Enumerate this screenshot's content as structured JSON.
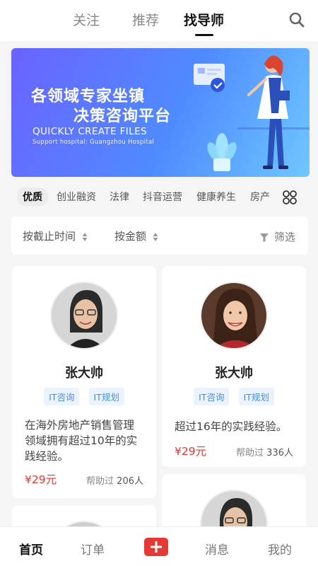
{
  "top_tabs": [
    {
      "label": "关注"
    },
    {
      "label": "推荐"
    },
    {
      "label": "找导师"
    }
  ],
  "search_icon": "search-icon",
  "banner": {
    "title_line1": "各领域专家坐镇",
    "title_line2": "决策咨询平台",
    "english": "QUICKLY CREATE FILES",
    "small": "Support hospital: Guangzhou Hospital"
  },
  "categories": [
    "优质",
    "创业融资",
    "法律",
    "抖音运营",
    "健康养生",
    "房产"
  ],
  "sort": {
    "by_deadline": "按截止时间",
    "by_amount": "按金额",
    "filter": "筛选"
  },
  "cards": [
    {
      "name": "张大帅",
      "tags": [
        "IT咨询",
        "IT规划"
      ],
      "description": "在海外房地产销售管理领域拥有超过10年的实践经验。",
      "price": "¥29元",
      "helped_label": "帮助过",
      "helped_count": "206人"
    },
    {
      "name": "张大帅",
      "tags": [
        "IT咨询",
        "IT规划"
      ],
      "description": "超过16年的实践经验。",
      "price": "¥29元",
      "helped_label": "帮助过",
      "helped_count": "336人"
    }
  ],
  "bottom_nav": [
    {
      "label": "首页"
    },
    {
      "label": "订单"
    },
    {
      "label": "消息"
    },
    {
      "label": "我的"
    }
  ],
  "colors": {
    "accent": "#e53935",
    "tag_text": "#4a8fd8",
    "banner_start": "#6a63ff",
    "banner_end": "#6ec7ff"
  }
}
